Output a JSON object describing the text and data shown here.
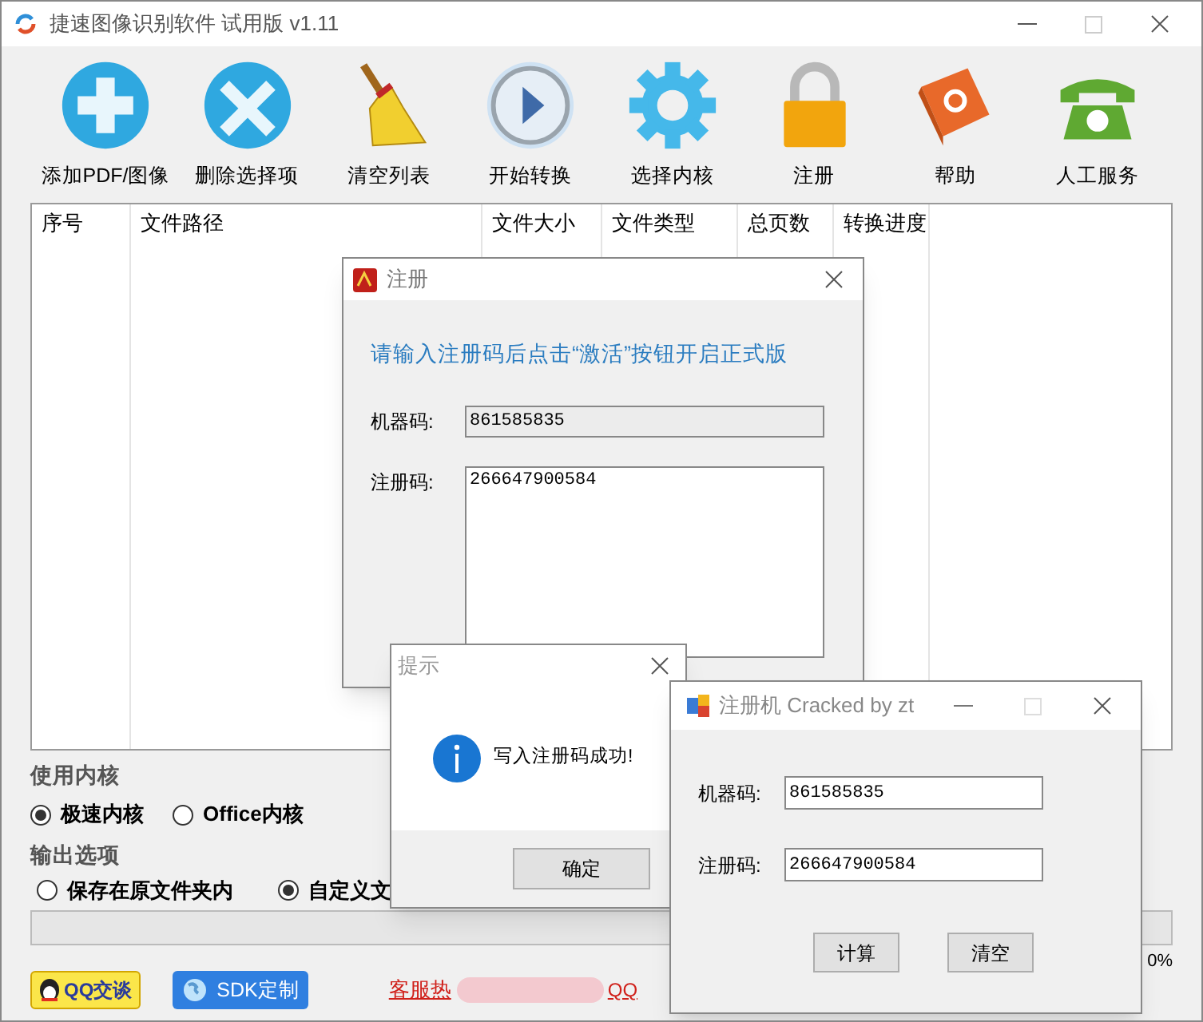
{
  "window": {
    "title": "捷速图像识别软件 试用版 v1.11"
  },
  "toolbar": [
    {
      "label": "添加PDF/图像",
      "kind": "add"
    },
    {
      "label": "删除选择项",
      "kind": "delete"
    },
    {
      "label": "清空列表",
      "kind": "broom"
    },
    {
      "label": "开始转换",
      "kind": "play"
    },
    {
      "label": "选择内核",
      "kind": "gear"
    },
    {
      "label": "注册",
      "kind": "lock"
    },
    {
      "label": "帮助",
      "kind": "book"
    },
    {
      "label": "人工服务",
      "kind": "phone"
    }
  ],
  "table": {
    "columns": [
      "序号",
      "文件路径",
      "文件大小",
      "文件类型",
      "总页数",
      "转换进度"
    ]
  },
  "engine": {
    "label": "使用内核",
    "options": [
      {
        "label": "极速内核",
        "selected": true
      },
      {
        "label": "Office内核",
        "selected": false
      }
    ]
  },
  "output": {
    "label": "输出选项",
    "options": [
      {
        "label": "保存在原文件夹内",
        "selected": false
      },
      {
        "label": "自定义文",
        "selected": true
      }
    ]
  },
  "progress": {
    "level": 0,
    "reading": "0%"
  },
  "footer": {
    "qq_button": "QQ交谈",
    "sdk_button": "SDK定制",
    "hotline": "客服热",
    "qq_link": "QQ"
  },
  "register_dialog": {
    "title": "注册",
    "prompt": "请输入注册码后点击“激活”按钮开启正式版",
    "machine_code_label": "机器码:",
    "machine_code": "861585835",
    "reg_code_label": "注册码:",
    "reg_code": "266647900584"
  },
  "message_box": {
    "title": "提示",
    "message": "写入注册码成功!",
    "ok_button": "确定"
  },
  "keygen": {
    "title": "注册机 Cracked by zt",
    "machine_code_label": "机器码:",
    "machine_code": "861585835",
    "reg_code_label": "注册码:",
    "reg_code": "266647900584",
    "buttons": [
      "计算",
      "清空"
    ]
  }
}
